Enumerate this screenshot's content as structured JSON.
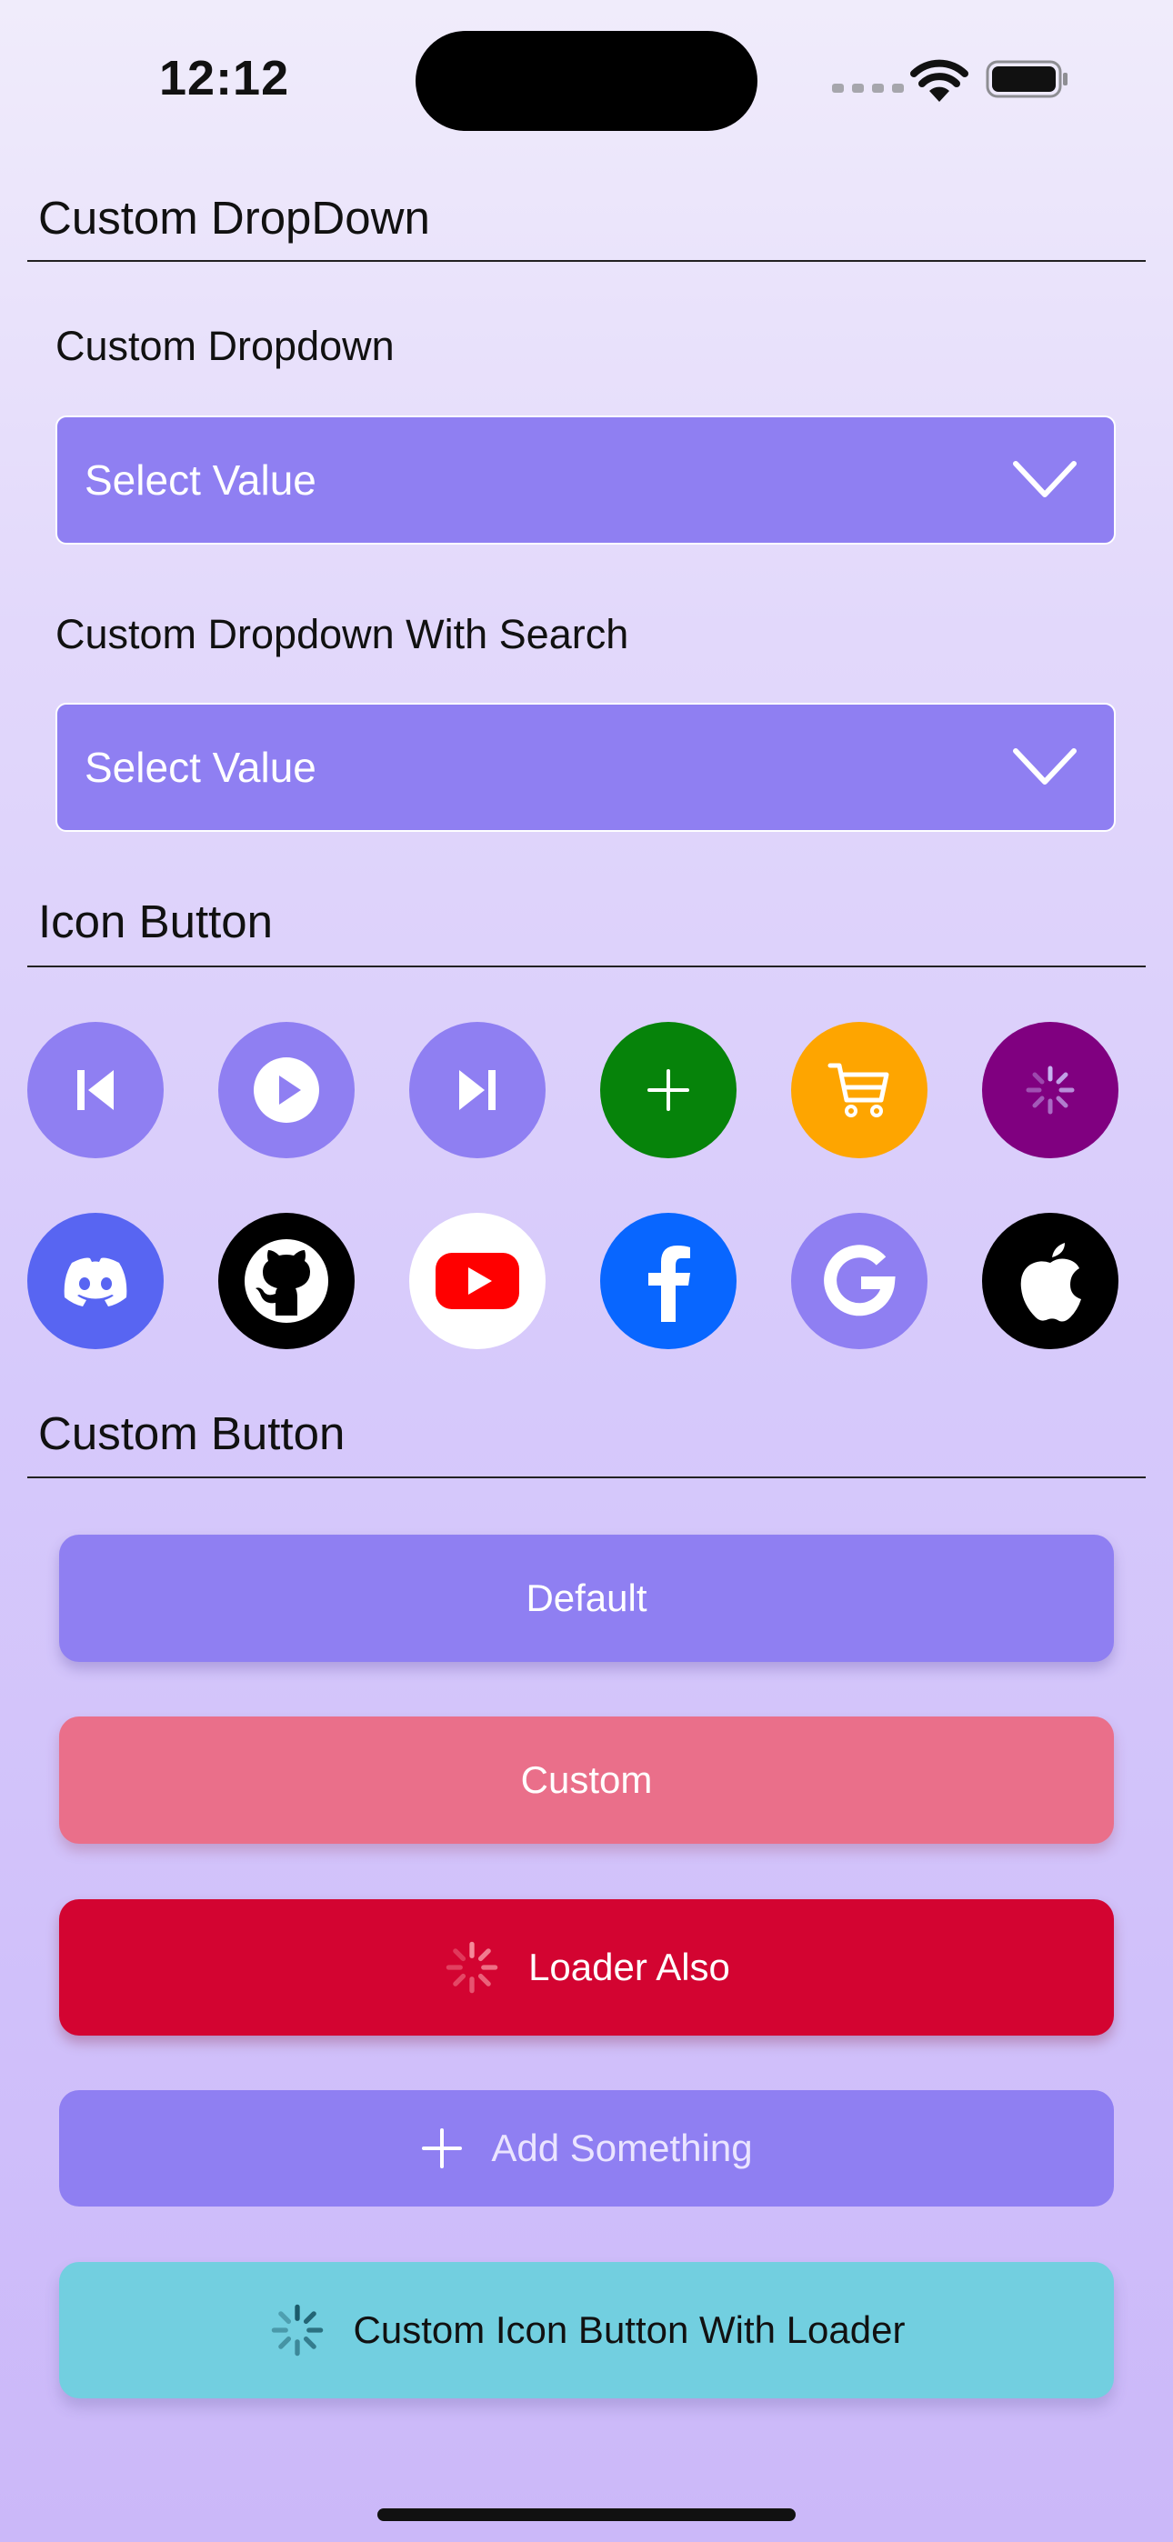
{
  "status_bar": {
    "time": "12:12"
  },
  "sections": {
    "dropdown_title": "Custom DropDown",
    "icon_button_title": "Icon Button",
    "custom_button_title": "Custom Button"
  },
  "dropdowns": [
    {
      "label": "Custom Dropdown",
      "value": "Select Value"
    },
    {
      "label": "Custom Dropdown With Search",
      "value": "Select Value"
    }
  ],
  "icon_buttons_row1": [
    {
      "icon": "skip-previous-icon",
      "color": "#8f7ff2"
    },
    {
      "icon": "play-icon",
      "color": "#8f7ff2"
    },
    {
      "icon": "skip-next-icon",
      "color": "#8f7ff2"
    },
    {
      "icon": "plus-icon",
      "color": "#06830a"
    },
    {
      "icon": "cart-icon",
      "color": "#fea500"
    },
    {
      "icon": "spinner-icon",
      "color": "#800080"
    }
  ],
  "icon_buttons_row2": [
    {
      "icon": "discord-icon",
      "color": "#5865f2"
    },
    {
      "icon": "github-icon",
      "color": "#000000"
    },
    {
      "icon": "youtube-icon",
      "color": "#ffffff"
    },
    {
      "icon": "facebook-icon",
      "color": "#0866ff"
    },
    {
      "icon": "google-icon",
      "color": "#8f7ff2"
    },
    {
      "icon": "apple-icon",
      "color": "#000000"
    }
  ],
  "buttons": [
    {
      "label": "Default",
      "color": "#8f7ff2"
    },
    {
      "label": "Custom",
      "color": "#ea6f8a"
    },
    {
      "label": "Loader Also",
      "color": "#d30431"
    },
    {
      "label": "Add Something",
      "color": "#8f7ff2"
    },
    {
      "label": "Custom Icon Button With Loader",
      "color": "#72cfe0"
    }
  ]
}
